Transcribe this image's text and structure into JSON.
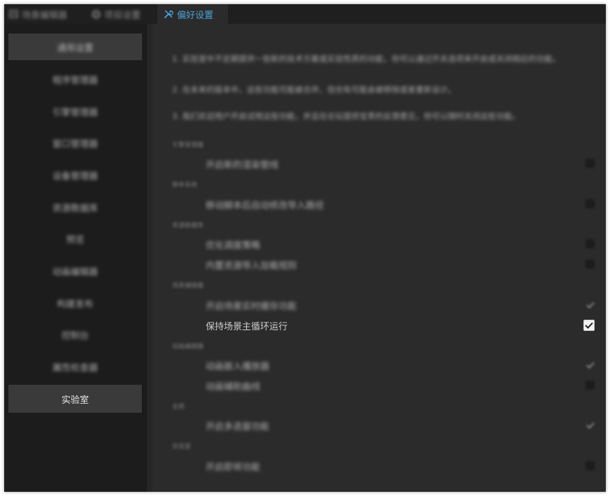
{
  "tabs": [
    {
      "label": "场景编辑器",
      "icon": "scene-editor-icon",
      "blurred": true
    },
    {
      "label": "项目设置",
      "icon": "gear-icon",
      "blurred": true
    },
    {
      "label": "偏好设置",
      "icon": "tools-icon",
      "blurred": false,
      "active": true
    }
  ],
  "sidebar": {
    "items": [
      {
        "label": "通用设置",
        "blurred": true,
        "active": true
      },
      {
        "label": "程序管理器",
        "blurred": true
      },
      {
        "label": "引擎管理器",
        "blurred": true
      },
      {
        "label": "窗口管理器",
        "blurred": true
      },
      {
        "label": "设备管理器",
        "blurred": true
      },
      {
        "label": "资源数据库",
        "blurred": true
      },
      {
        "label": "预览",
        "blurred": true
      },
      {
        "label": "动画编辑器",
        "blurred": true
      },
      {
        "label": "构建发布",
        "blurred": true
      },
      {
        "label": "控制台",
        "blurred": true
      },
      {
        "label": "属性检查器",
        "blurred": true
      },
      {
        "label": "实验室",
        "blurred": false,
        "active": true
      }
    ]
  },
  "lab": {
    "descriptions": [
      "1. 实验室中不定期提供一些新的技术方案或实验性质的功能，你可以通过开关选项来开启或关闭相应的功能。",
      "2. 在未来的版本中，这些功能可能被合并、但也有可能会被移除或者重新设计。",
      "3. 我们欢迎用户开启试用这些功能，并且在论坛提供宝贵的反馈意见，你可以随时关闭这些功能。"
    ],
    "groups": [
      {
        "title": "引擎管理器",
        "options": [
          {
            "label": "开启新的渲染管线",
            "checked": false,
            "blurred": true
          }
        ]
      },
      {
        "title": "脚本系统",
        "options": [
          {
            "label": "移动脚本后自动修改导入路径",
            "checked": false,
            "blurred": true
          }
        ]
      },
      {
        "title": "资源数据库",
        "options": [
          {
            "label": "优化调度策略",
            "checked": false,
            "blurred": true
          },
          {
            "label": "内置资源导入加载规则",
            "checked": false,
            "blurred": true
          }
        ]
      },
      {
        "title": "场景编辑器",
        "options": [
          {
            "label": "开启场景实时缓存功能",
            "checked": true,
            "blurred": true
          },
          {
            "label": "保持场景主循环运行",
            "checked": true,
            "blurred": false
          }
        ]
      },
      {
        "title": "动画编辑器",
        "options": [
          {
            "label": "动画嵌入播放器",
            "checked": true,
            "blurred": true
          },
          {
            "label": "动画辅助曲线",
            "checked": false,
            "blurred": true
          }
        ]
      },
      {
        "title": "全局",
        "options": [
          {
            "label": "开启多选窗功能",
            "checked": true,
            "blurred": true
          }
        ]
      },
      {
        "title": "实验室",
        "options": [
          {
            "label": "开启即将功能",
            "checked": false,
            "blurred": true
          }
        ]
      }
    ]
  },
  "colors": {
    "accent": "#4aa3d8",
    "panel": "#2b2b2b",
    "sidebar": "#1c1c1c",
    "tabbar": "#1f1f1f"
  }
}
